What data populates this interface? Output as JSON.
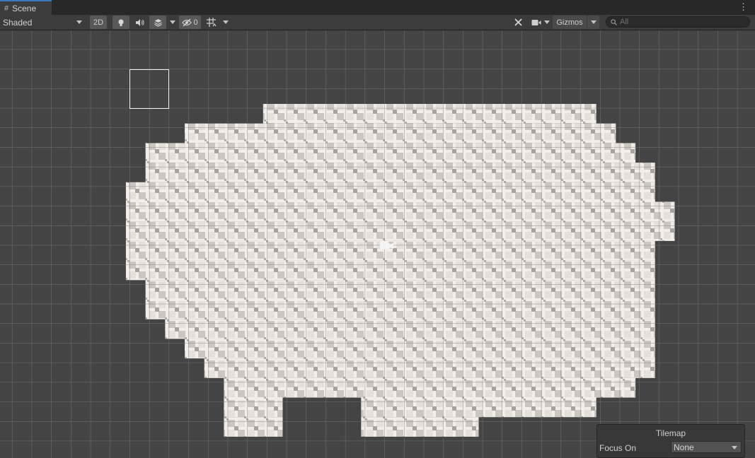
{
  "tab": {
    "label": "Scene",
    "icon": "hash-grid-icon"
  },
  "toolbar": {
    "draw_mode": "Shaded",
    "mode_2d": "2D",
    "hidden_count": "0",
    "gizmos": "Gizmos",
    "search_placeholder": "All"
  },
  "overlay": {
    "title": "Tilemap",
    "focus_label": "Focus On",
    "focus_value": "None"
  },
  "colors": {
    "viewport_bg": "#444444",
    "grid_line": "#7a7a7a",
    "tile_light": "#f3eee9",
    "tile_dark": "#b9b3ae",
    "accent": "#3a79bb"
  },
  "tilemap": {
    "rows": [
      {
        "row": 0,
        "spans": [
          [
            -6,
            11
          ]
        ]
      },
      {
        "row": 1,
        "spans": [
          [
            -10,
            12
          ]
        ]
      },
      {
        "row": 2,
        "spans": [
          [
            -12,
            13
          ]
        ]
      },
      {
        "row": 3,
        "spans": [
          [
            -12,
            14
          ]
        ]
      },
      {
        "row": 4,
        "spans": [
          [
            -13,
            14
          ]
        ]
      },
      {
        "row": 5,
        "spans": [
          [
            -13,
            15
          ]
        ]
      },
      {
        "row": 6,
        "spans": [
          [
            -13,
            15
          ]
        ]
      },
      {
        "row": 7,
        "spans": [
          [
            -13,
            14
          ]
        ]
      },
      {
        "row": 8,
        "spans": [
          [
            -13,
            14
          ]
        ]
      },
      {
        "row": 9,
        "spans": [
          [
            -12,
            14
          ]
        ]
      },
      {
        "row": 10,
        "spans": [
          [
            -12,
            14
          ]
        ]
      },
      {
        "row": 11,
        "spans": [
          [
            -11,
            14
          ]
        ]
      },
      {
        "row": 12,
        "spans": [
          [
            -10,
            14
          ]
        ]
      },
      {
        "row": 13,
        "spans": [
          [
            -9,
            14
          ]
        ]
      },
      {
        "row": 14,
        "spans": [
          [
            -8,
            13
          ]
        ]
      },
      {
        "row": 15,
        "spans": [
          [
            -8,
            -5
          ],
          [
            -1,
            11
          ]
        ]
      },
      {
        "row": 16,
        "spans": [
          [
            -8,
            -5
          ],
          [
            -1,
            5
          ]
        ]
      }
    ]
  }
}
